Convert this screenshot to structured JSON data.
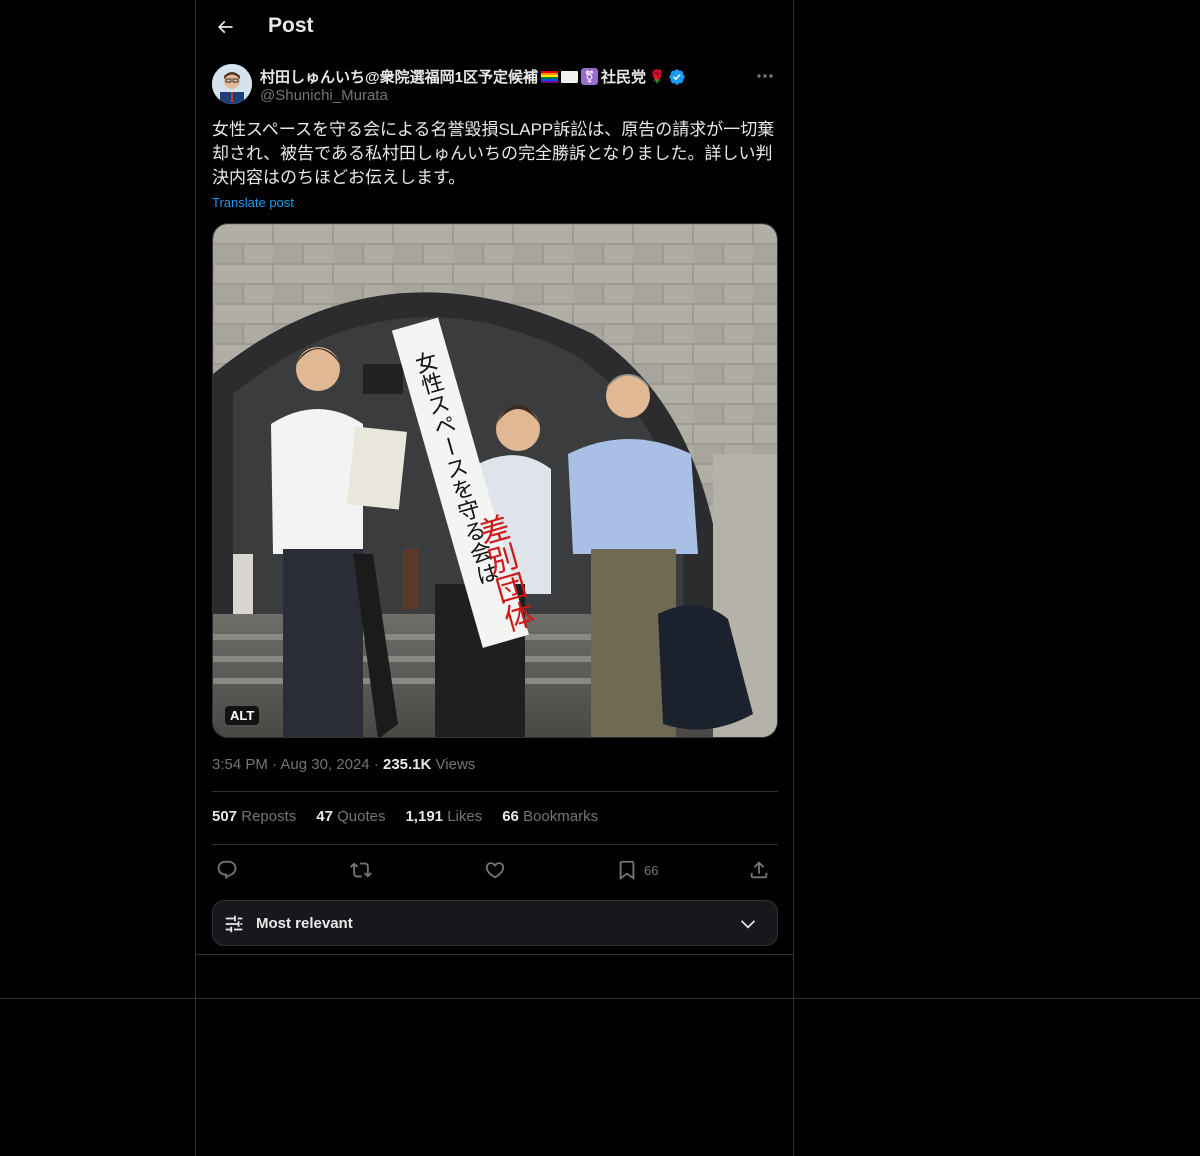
{
  "header": {
    "title": "Post"
  },
  "author": {
    "name": "村田しゅんいち@衆院選福岡1区予定候補",
    "party": "社民党",
    "handle": "@Shunichi_Murata"
  },
  "post": {
    "text": "女性スペースを守る会による名誉毀損SLAPP訴訟は、原告の請求が一切棄却され、被告である私村田しゅんいちの完全勝訴となりました。詳しい判決内容はのちほどお伝えします。",
    "translate_label": "Translate post",
    "media_alt_badge": "ALT",
    "banner_text_black": "女性スペースを守る会は",
    "banner_text_red": "差別団体",
    "time": "3:54 PM",
    "date": "Aug 30, 2024",
    "views_count": "235.1K",
    "views_label": "Views"
  },
  "stats": {
    "reposts_count": "507",
    "reposts_label": "Reposts",
    "quotes_count": "47",
    "quotes_label": "Quotes",
    "likes_count": "1,191",
    "likes_label": "Likes",
    "bookmarks_count": "66",
    "bookmarks_label": "Bookmarks"
  },
  "actions": {
    "bookmark_count": "66"
  },
  "sort": {
    "label": "Most relevant"
  },
  "colors": {
    "background": "#000000",
    "text": "#e7e9ea",
    "muted": "#71767b",
    "accent": "#1d9bf0",
    "border": "#2f3336"
  }
}
